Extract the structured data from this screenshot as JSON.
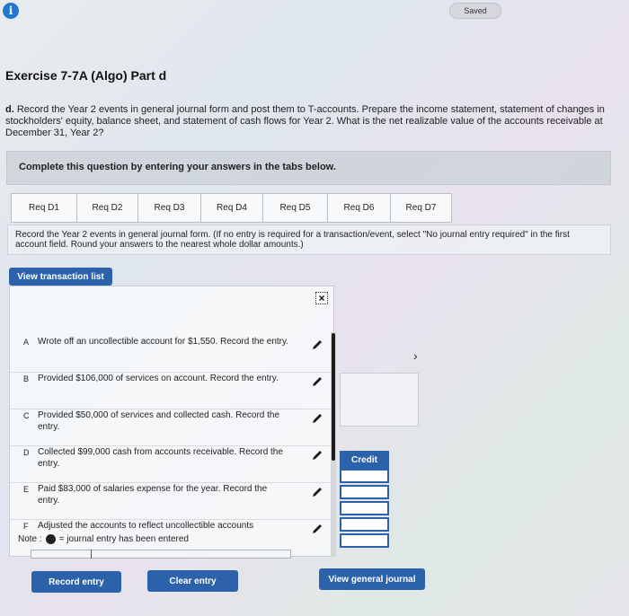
{
  "topbar": {
    "saved_label": "Saved"
  },
  "exercise": {
    "title": "Exercise 7-7A (Algo) Part d",
    "part_label": "d.",
    "question": "Record the Year 2 events in general journal form and post them to T-accounts. Prepare the income statement, statement of changes in stockholders' equity, balance sheet, and statement of cash flows for Year 2. What is the net realizable value of the accounts receivable at December 31, Year 2?"
  },
  "complete_label": "Complete this question by entering your answers in the tabs below.",
  "tabs": [
    {
      "label": "Req D1"
    },
    {
      "label": "Req D2"
    },
    {
      "label": "Req D3"
    },
    {
      "label": "Req D4"
    },
    {
      "label": "Req D5"
    },
    {
      "label": "Req D6"
    },
    {
      "label": "Req D7"
    }
  ],
  "instructions": "Record the Year 2 events in general journal form. (If no entry is required for a transaction/event, select \"No journal entry required\" in the first account field. Round your answers to the nearest whole dollar amounts.)",
  "view_transaction_list_label": "View transaction list",
  "transactions": [
    {
      "letter": "A",
      "text": "Wrote off an uncollectible account for $1,550. Record the entry."
    },
    {
      "letter": "B",
      "text": "Provided $106,000 of services on account. Record the entry."
    },
    {
      "letter": "C",
      "text": "Provided $50,000 of services and collected cash. Record the entry."
    },
    {
      "letter": "D",
      "text": "Collected $99,000 cash from accounts receivable. Record the entry."
    },
    {
      "letter": "E",
      "text": "Paid $83,000 of salaries expense for the year. Record the entry."
    },
    {
      "letter": "F",
      "text": "Adjusted the accounts to reflect uncollectible accounts"
    }
  ],
  "note": {
    "prefix": "Note :",
    "suffix": "= journal entry has been entered"
  },
  "credit_header": "Credit",
  "buttons": {
    "record_entry": "Record entry",
    "clear_entry": "Clear entry",
    "view_general_journal": "View general journal"
  },
  "colors": {
    "accent": "#2c62a9",
    "info": "#1f77d0"
  }
}
